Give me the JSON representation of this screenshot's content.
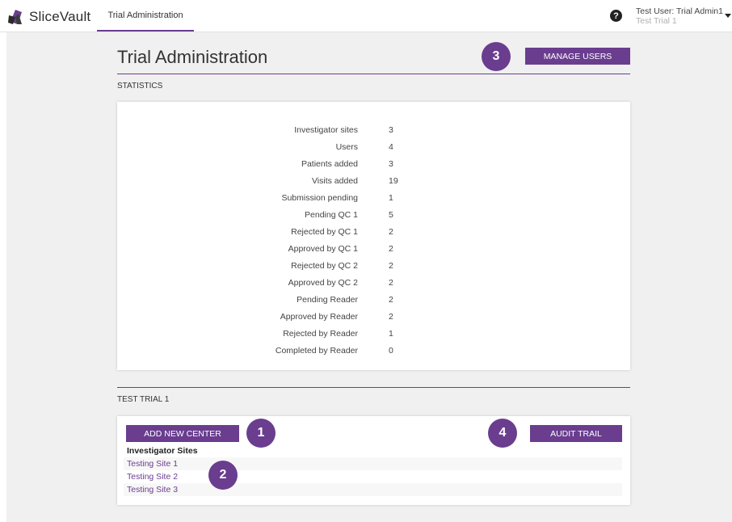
{
  "header": {
    "logo_text_a": "Slice",
    "logo_text_b": "Vault",
    "nav_tab": "Trial Administration",
    "help_icon": "question-circle-icon",
    "user_name": "Test User: Trial Admin1",
    "user_trial": "Test Trial 1"
  },
  "colors": {
    "accent": "#6a3d8f",
    "background": "#f0f0f0"
  },
  "main": {
    "title": "Trial Administration",
    "manage_users_label": "MANAGE USERS",
    "statistics_label": "STATISTICS",
    "stats": [
      {
        "label": "Investigator sites",
        "value": "3"
      },
      {
        "label": "Users",
        "value": "4"
      },
      {
        "label": "Patients added",
        "value": "3"
      },
      {
        "label": "Visits added",
        "value": "19"
      },
      {
        "label": "Submission pending",
        "value": "1"
      },
      {
        "label": "Pending QC 1",
        "value": "5"
      },
      {
        "label": "Rejected by QC 1",
        "value": "2"
      },
      {
        "label": "Approved by QC 1",
        "value": "2"
      },
      {
        "label": "Rejected by QC 2",
        "value": "2"
      },
      {
        "label": "Approved by QC 2",
        "value": "2"
      },
      {
        "label": "Pending Reader",
        "value": "2"
      },
      {
        "label": "Approved by Reader",
        "value": "2"
      },
      {
        "label": "Rejected by Reader",
        "value": "1"
      },
      {
        "label": "Completed by Reader",
        "value": "0"
      }
    ],
    "trial_label": "TEST TRIAL 1",
    "add_center_label": "ADD NEW CENTER",
    "audit_trail_label": "AUDIT TRAIL",
    "sites_heading": "Investigator Sites",
    "sites": [
      "Testing Site 1",
      "Testing Site 2",
      "Testing Site 3"
    ]
  },
  "badges": [
    "1",
    "2",
    "3",
    "4"
  ]
}
